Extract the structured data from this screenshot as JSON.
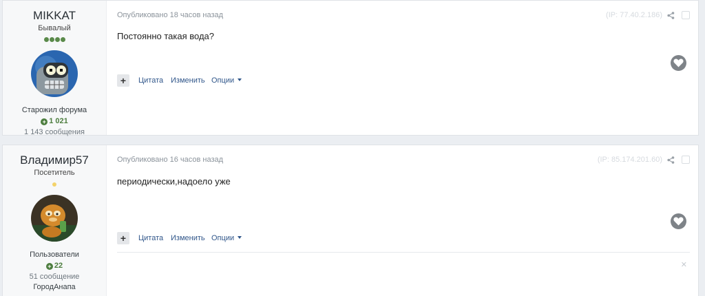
{
  "posts": [
    {
      "author": {
        "name": "MIKKAT",
        "title": "Бывалый",
        "pips": 4,
        "group": "Старожил форума",
        "reputation": "1 021",
        "post_count": "1 143 сообщения",
        "city": ""
      },
      "meta": "Опубликовано 18 часов назад",
      "ip": "(IP: 77.40.2.186)",
      "content": "Постоянно такая вода?",
      "actions": {
        "multiquote": "+",
        "quote": "Цитата",
        "edit": "Изменить",
        "options": "Опции"
      }
    },
    {
      "author": {
        "name": "Владимир57",
        "title": "Посетитель",
        "pips": 1,
        "group": "Пользователи",
        "reputation": "22",
        "post_count": "51 сообщение",
        "city": "ГородАнапа"
      },
      "meta": "Опубликовано 16 часов назад",
      "ip": "(IP: 85.174.201.60)",
      "content": "периодически,надоело уже",
      "actions": {
        "multiquote": "+",
        "quote": "Цитата",
        "edit": "Изменить",
        "options": "Опции"
      }
    }
  ],
  "colors": {
    "link": "#30568a",
    "rep": "#4c7d3e",
    "pip": "#5a8a4a",
    "pip_new": "#f3d36b",
    "heart": "#7e8388"
  },
  "icons": [
    "share-icon",
    "heart-icon",
    "plus-icon",
    "caret-down-icon",
    "close-icon"
  ]
}
